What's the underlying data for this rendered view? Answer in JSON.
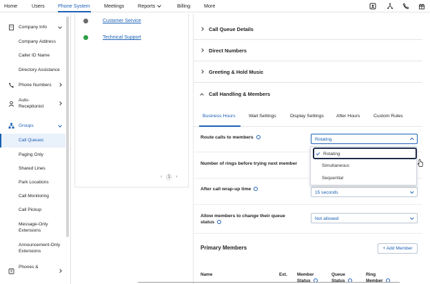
{
  "topnav": {
    "items": [
      {
        "label": "Home"
      },
      {
        "label": "Users"
      },
      {
        "label": "Phone System"
      },
      {
        "label": "Meetings"
      },
      {
        "label": "Reports"
      },
      {
        "label": "Billing"
      },
      {
        "label": "More"
      }
    ],
    "active": "Phone System",
    "icons": [
      "contact-card-icon",
      "org-tree-icon",
      "phone-icon",
      "gift-icon"
    ]
  },
  "sidebar": {
    "items": [
      {
        "label": "Company Info",
        "icon": "building-icon",
        "expanded": true
      },
      {
        "label": "Company Address"
      },
      {
        "label": "Caller ID Name"
      },
      {
        "label": "Directory Assistance"
      },
      {
        "label": "Phone Numbers",
        "icon": "phone-icon"
      },
      {
        "label": "Auto-",
        "label2": "Receptionist",
        "icon": "receptionist-icon"
      },
      {
        "label": "Groups",
        "icon": "groups-icon",
        "expanded": true
      },
      {
        "label": "Call Queues",
        "active": true
      },
      {
        "label": "Paging Only"
      },
      {
        "label": "Shared Lines"
      },
      {
        "label": "Park Locations"
      },
      {
        "label": "Call Monitoring"
      },
      {
        "label": "Call Pickup"
      },
      {
        "label": "Message-Only",
        "label2": "Extensions"
      },
      {
        "label": "Announcement-Only",
        "label2": "Extensions"
      },
      {
        "label": "Phones &",
        "icon": "device-icon"
      }
    ]
  },
  "queue_list": {
    "rows": [
      {
        "name": "Customer Service",
        "status_color": "#6b6b6b"
      },
      {
        "name": "Technical Support",
        "status_color": "#2e9e47"
      }
    ],
    "pager": {
      "page": "1"
    }
  },
  "sections": {
    "call_queue_details": "Call Queue Details",
    "direct_numbers": "Direct Numbers",
    "greeting_hold": "Greeting & Hold Music",
    "call_handling": "Call Handling & Members"
  },
  "tabs": [
    {
      "label": "Business Hours",
      "active": true
    },
    {
      "label": "Wait Settings"
    },
    {
      "label": "Display Settings"
    },
    {
      "label": "After Hours"
    },
    {
      "label": "Custom Rules"
    }
  ],
  "fields": {
    "route_calls": {
      "label": "Route calls to members",
      "value": "Rotating"
    },
    "rings": {
      "label": "Number of rings before trying next member"
    },
    "wrapup": {
      "label": "After call wrap-up time",
      "value": "15 seconds"
    },
    "allow_change": {
      "label": "Allow members to change their queue",
      "label2": "status",
      "value": "Not allowed"
    }
  },
  "dropdown": {
    "options": [
      {
        "label": "Rotating",
        "selected": true
      },
      {
        "label": "Simultaneous"
      },
      {
        "label": "Sequential"
      }
    ]
  },
  "primary_members": {
    "title": "Primary Members",
    "add_label": "+ Add Member",
    "columns": [
      {
        "label": "Name"
      },
      {
        "label": "Ext."
      },
      {
        "label": "Member",
        "label2": "Status"
      },
      {
        "label": "Queue",
        "label2": "Status"
      },
      {
        "label": "Ring",
        "label2": "Member"
      }
    ]
  },
  "colors": {
    "accent": "#1a5fb4",
    "active_bg": "#e9f1fb",
    "focus_ring": "#1b2a48"
  }
}
